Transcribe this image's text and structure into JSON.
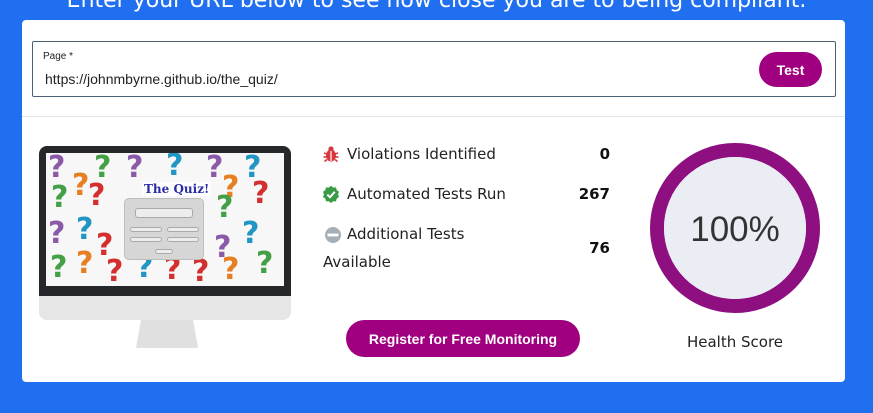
{
  "header": {
    "intro_text": "Enter your URL below to see how close you are to being compliant."
  },
  "url_form": {
    "label": "Page *",
    "value": "https://johnmbyrne.github.io/the_quiz/",
    "test_label": "Test"
  },
  "preview": {
    "quiz_title": "The Quiz!",
    "question_colors": [
      "#8a5aa8",
      "#43a047",
      "#2196c4",
      "#e67e22",
      "#d32f2f"
    ]
  },
  "stats": [
    {
      "icon": "bug-icon",
      "label": "Violations Identified",
      "value": "0",
      "color": "#d9363e"
    },
    {
      "icon": "check-badge-icon",
      "label": "Automated Tests Run",
      "value": "267",
      "color": "#3a9b45"
    },
    {
      "icon": "minus-circle-icon",
      "label_line1": "Additional Tests",
      "label_line2": "Available",
      "value": "76",
      "color": "#9aa5ad"
    }
  ],
  "register_label": "Register for Free Monitoring",
  "health": {
    "score": "100%",
    "fraction": 1.0,
    "label": "Health Score",
    "ring_color": "#8e0f80",
    "inner_color": "#eaeef4"
  }
}
